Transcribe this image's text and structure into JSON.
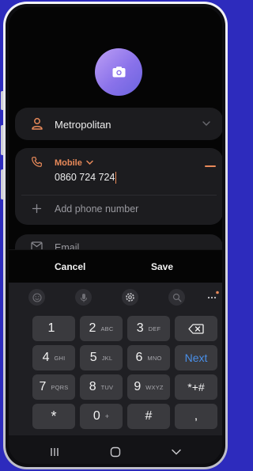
{
  "contact": {
    "account_label": "Metropolitan",
    "phone_type": "Mobile",
    "phone_number": "0860 724 724",
    "add_phone_placeholder": "Add phone number",
    "email_placeholder": "Email"
  },
  "actions": {
    "cancel": "Cancel",
    "save": "Save"
  },
  "keypad": {
    "rows": [
      [
        {
          "digit": "1",
          "letters": ""
        },
        {
          "digit": "2",
          "letters": "ABC"
        },
        {
          "digit": "3",
          "letters": "DEF"
        }
      ],
      [
        {
          "digit": "4",
          "letters": "GHI"
        },
        {
          "digit": "5",
          "letters": "JKL"
        },
        {
          "digit": "6",
          "letters": "MNO"
        }
      ],
      [
        {
          "digit": "7",
          "letters": "PQRS"
        },
        {
          "digit": "8",
          "letters": "TUV"
        },
        {
          "digit": "9",
          "letters": "WXYZ"
        }
      ],
      [
        {
          "digit": "*",
          "letters": ""
        },
        {
          "digit": "0",
          "letters": "+"
        },
        {
          "digit": "#",
          "letters": ""
        }
      ]
    ],
    "next_label": "Next",
    "symbols_label": "*+#",
    "comma_label": ","
  },
  "colors": {
    "accent_orange": "#e98a5a",
    "next_blue": "#4a8fe8",
    "avatar_gradient": [
      "#bd9ff5",
      "#6a64de"
    ],
    "background": "#2d2bbd"
  },
  "icons": {
    "account": "person-icon",
    "phone": "phone-icon",
    "add": "plus-icon",
    "email": "mail-icon",
    "toolbar": [
      "emoji-icon",
      "microphone-icon",
      "settings-icon",
      "search-icon",
      "more-icon"
    ],
    "nav": [
      "recents-icon",
      "home-icon",
      "back-icon"
    ]
  }
}
